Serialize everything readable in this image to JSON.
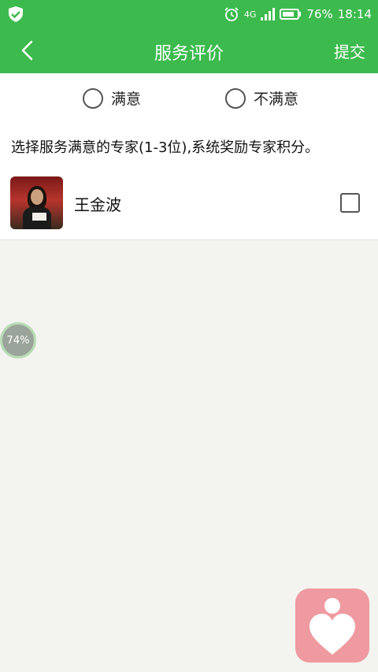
{
  "status_bar": {
    "network": "4G",
    "battery": "76%",
    "time": "18:14"
  },
  "nav": {
    "title": "服务评价",
    "submit_label": "提交"
  },
  "rating": {
    "options": [
      "满意",
      "不满意"
    ]
  },
  "hint": "选择服务满意的专家(1-3位),系统奖励专家积分。",
  "experts": [
    {
      "name": "王金波"
    }
  ],
  "badge": {
    "progress_label": "74%"
  },
  "colors": {
    "header": "#3dba4e",
    "fab": "#ef9aa0"
  }
}
